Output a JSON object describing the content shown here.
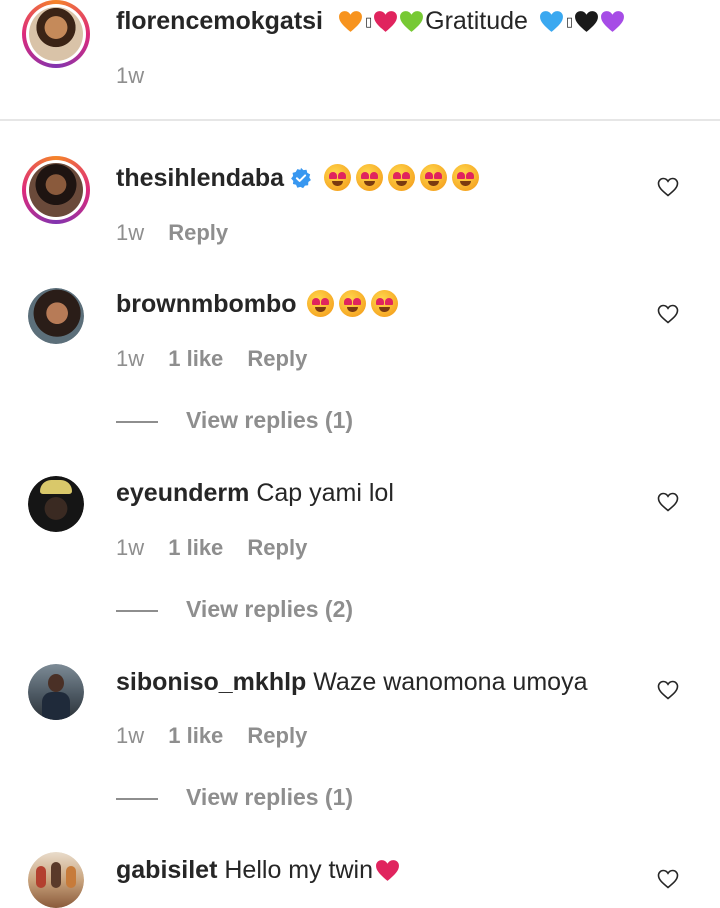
{
  "caption": {
    "username": "florencemokgatsi",
    "text_word": "Gratitude",
    "time": "1w",
    "emojis_before": [
      "orange-heart",
      "tofu",
      "red-heart",
      "green-heart"
    ],
    "emojis_after": [
      "blue-heart",
      "tofu",
      "black-heart",
      "purple-heart"
    ],
    "tofu_glyph": "▯"
  },
  "comments": [
    {
      "username": "thesihlendaba",
      "verified": true,
      "text": "",
      "emojis": [
        "heart-eyes",
        "heart-eyes",
        "heart-eyes",
        "heart-eyes",
        "heart-eyes"
      ],
      "time": "1w",
      "likes": "",
      "reply_label": "Reply",
      "view_replies": ""
    },
    {
      "username": "brownmbombo",
      "text": "",
      "emojis": [
        "heart-eyes",
        "heart-eyes",
        "heart-eyes"
      ],
      "time": "1w",
      "likes": "1 like",
      "reply_label": "Reply",
      "view_replies": "View replies (1)"
    },
    {
      "username": "eyeunderm",
      "text": "Cap yami lol",
      "time": "1w",
      "likes": "1 like",
      "reply_label": "Reply",
      "view_replies": "View replies (2)"
    },
    {
      "username": "siboniso_mkhlp",
      "text": "Waze wanomona umoya",
      "time": "1w",
      "likes": "1 like",
      "reply_label": "Reply",
      "view_replies": "View replies (1)"
    },
    {
      "username": "gabisilet",
      "text": "Hello my twin",
      "emojis_after": [
        "red-heart"
      ]
    }
  ],
  "colors": {
    "text": "#262626",
    "muted": "#8e8e8e",
    "verified": "#3897f0",
    "story_ring_start": "#f58529",
    "story_ring_end": "#dd2a7b"
  }
}
